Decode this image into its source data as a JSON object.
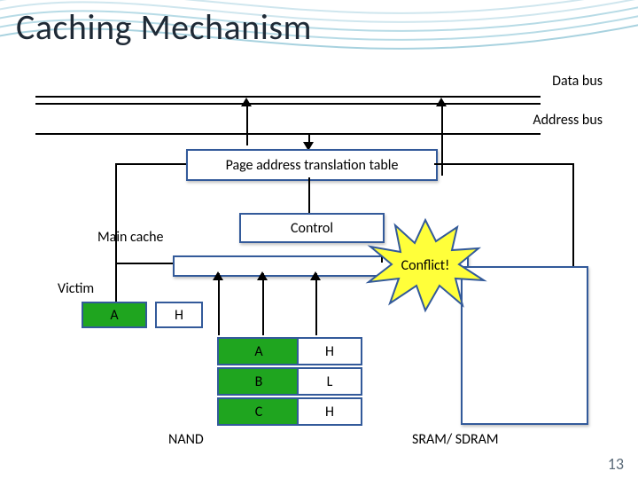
{
  "title": "Caching Mechanism",
  "labels": {
    "data_bus": "Data bus",
    "address_bus": "Address bus",
    "page_table": "Page address translation table",
    "control": "Control",
    "main_cache": "Main cache",
    "victim": "Victim",
    "conflict": "Conflict!",
    "nand": "NAND",
    "sram": "SRAM/ SDRAM"
  },
  "victim_row": {
    "label": "A",
    "status": "H"
  },
  "nand_table": [
    {
      "label": "A",
      "status": "H"
    },
    {
      "label": "B",
      "status": "L"
    },
    {
      "label": "C",
      "status": "H"
    }
  ],
  "page_number": "13",
  "colors": {
    "border": "#335a9a",
    "green": "#1fa51f",
    "burst_fill": "#ffff3a",
    "burst_stroke": "#335a9a",
    "wave": "#b7dbe6"
  }
}
